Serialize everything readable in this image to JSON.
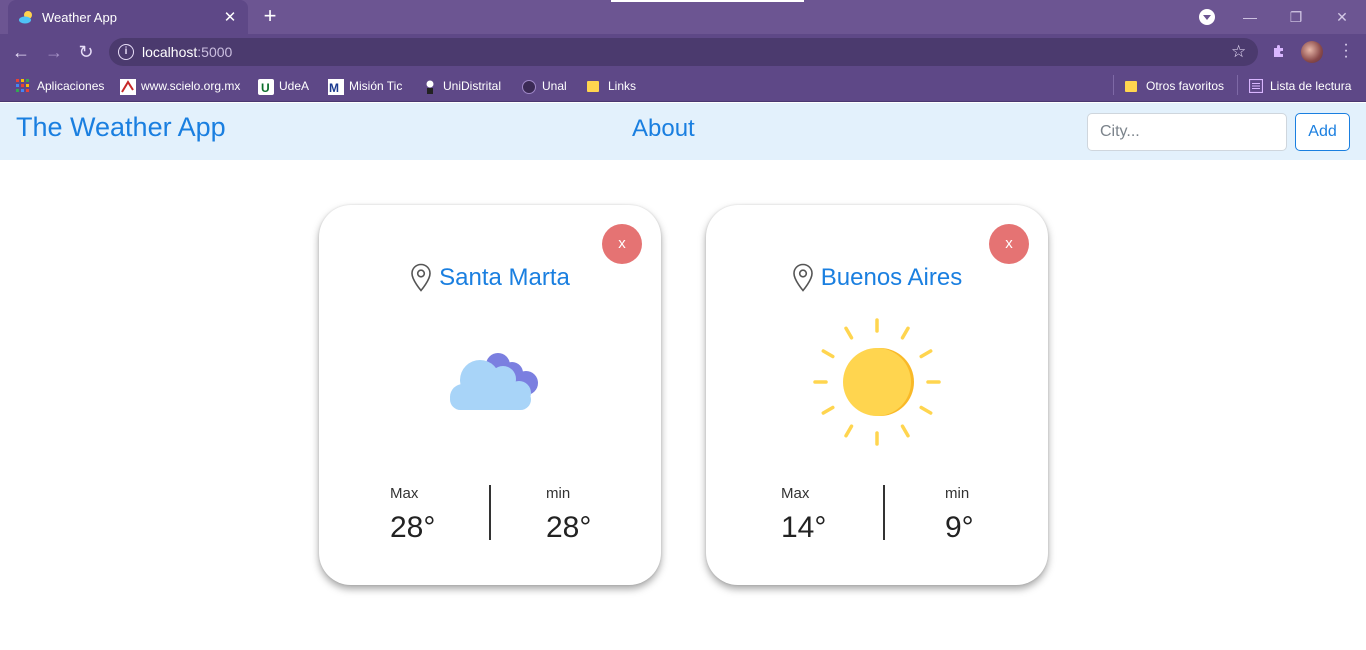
{
  "browser": {
    "tab_title": "Weather App",
    "tab_close": "✕",
    "new_tab": "+",
    "url_host": "localhost",
    "url_port": ":5000",
    "bookmarks": [
      {
        "label": "Aplicaciones",
        "icon": "apps-grid-icon"
      },
      {
        "label": "www.scielo.org.mx",
        "icon": "scielo-icon"
      },
      {
        "label": "UdeA",
        "icon": "udea-icon"
      },
      {
        "label": "Misión Tic",
        "icon": "mision-tic-icon"
      },
      {
        "label": "UniDistrital",
        "icon": "unidistrital-icon"
      },
      {
        "label": "Unal",
        "icon": "unal-icon"
      },
      {
        "label": "Links",
        "icon": "folder-icon"
      }
    ],
    "other_bookmarks": "Otros favoritos",
    "reading_list": "Lista de lectura"
  },
  "app": {
    "brand": "The Weather App",
    "about": "About",
    "search_placeholder": "City...",
    "add_label": "Add"
  },
  "cards": [
    {
      "city": "Santa Marta",
      "close_label": "x",
      "icon": "cloudy-icon",
      "max_label": "Max",
      "max_value": "28°",
      "min_label": "min",
      "min_value": "28°"
    },
    {
      "city": "Buenos Aires",
      "close_label": "x",
      "icon": "sunny-icon",
      "max_label": "Max",
      "max_value": "14°",
      "min_label": "min",
      "min_value": "9°"
    }
  ],
  "colors": {
    "brand_blue": "#1a7fe0",
    "navbar_bg": "#e3f1fc",
    "close_red": "#e57373",
    "browser_purple": "#5e4887"
  }
}
